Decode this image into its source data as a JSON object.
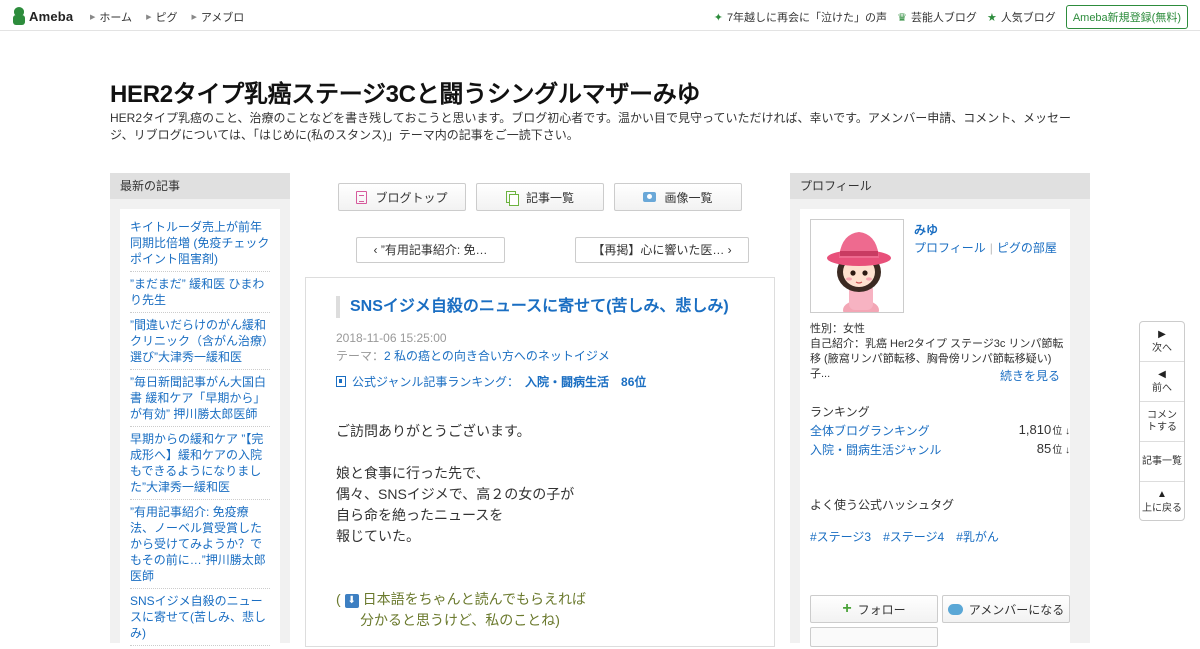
{
  "topbar": {
    "logo_text": "Ameba",
    "nav": [
      "ホーム",
      "ピグ",
      "アメブロ"
    ],
    "right_links": [
      {
        "icon": "sparkle-icon",
        "label": "7年越しに再会に「泣けた」の声"
      },
      {
        "icon": "crown-icon",
        "label": "芸能人ブログ"
      },
      {
        "icon": "star-icon",
        "label": "人気ブログ"
      }
    ],
    "signup_label": "Ameba新規登録(無料)"
  },
  "header": {
    "title": "HER2タイプ乳癌ステージ3Cと闘うシングルマザーみゆ",
    "description": "HER2タイプ乳癌のこと、治療のことなどを書き残しておこうと思います。ブログ初心者です。温かい目で見守っていただければ、幸いです。アメンバー申請、コメント、メッセージ、リブログについては、「はじめに(私のスタンス)」テーマ内の記事をご一読下さい。"
  },
  "left": {
    "heading": "最新の記事",
    "entries": [
      "キイトルーダ売上が前年同期比倍増 (免疫チェックポイント阻害剤)",
      "”まだまだ” 緩和医 ひまわり先生",
      "”間違いだらけのがん緩和クリニック（含がん治療）選び”大津秀一緩和医",
      "”毎日新聞記事がん大国白書 緩和ケア「早期から」が有効” 押川勝太郎医師",
      "早期からの緩和ケア ”【完成形へ】緩和ケアの入院もできるようになりました”大津秀一緩和医",
      "”有用記事紹介: 免疫療法、ノーベル賞受賞したから受けてみようか？でもその前に…”押川勝太郎医師",
      "SNSイジメ自殺のニュースに寄せて(苦しみ、悲しみ)"
    ]
  },
  "center": {
    "nav_buttons": [
      "ブログトップ",
      "記事一覧",
      "画像一覧"
    ],
    "prev_label": "”有用記事紹介: 免…",
    "next_label": "【再掲】心に響いた医…",
    "article": {
      "title": "SNSイジメ自殺のニュースに寄せて(苦しみ、悲しみ)",
      "date": "2018-11-06 15:25:00",
      "theme_prefix": "テーマ：",
      "theme": "2 私の癌との向き合い方へのネットイジメ",
      "ranking_label": "公式ジャンル記事ランキング：",
      "ranking_value": "入院・闘病生活　86位",
      "body": [
        "ご訪問ありがとうございます。",
        "",
        "娘と食事に行った先で、",
        "偶々、SNSイジメで、高２の女の子が",
        "自ら命を絶ったニュースを",
        "報じていた。",
        "",
        ""
      ],
      "quote_open": "(",
      "quote_line1": "日本語をちゃんと読んでもらえれば",
      "quote_line2": "分かると思うけど、私のことね)"
    }
  },
  "right": {
    "heading": "プロフィール",
    "name": "みゆ",
    "link_profile": "プロフィール",
    "link_pig": "ピグの部屋",
    "gender": "性別：女性",
    "intro": "自己紹介：乳癌 Her2タイプ ステージ3c リンパ節転移 (腋窩リンパ節転移、胸骨傍リンパ節転移疑い) 子...",
    "more": "続きを見る",
    "ranking_heading": "ランキング",
    "rankings": [
      {
        "label": "全体ブログランキング",
        "value": "1,810",
        "unit": "位 ↓"
      },
      {
        "label": "入院・闘病生活ジャンル",
        "value": "85",
        "unit": "位 ↓"
      }
    ],
    "tags_heading": "よく使う公式ハッシュタグ",
    "tags": [
      "#ステージ3",
      "#ステージ4",
      "#乳がん"
    ],
    "follow_label": "フォロー",
    "member_label": "アメンバーになる"
  },
  "sidenav": {
    "next": "次へ",
    "prev": "前へ",
    "comment": "コメントする",
    "list": "記事一覧",
    "top": "上に戻る"
  },
  "colors": {
    "brand_green": "#2d8c3c",
    "link_blue": "#1a6ec2",
    "panel_gray": "#f1f1f1"
  }
}
